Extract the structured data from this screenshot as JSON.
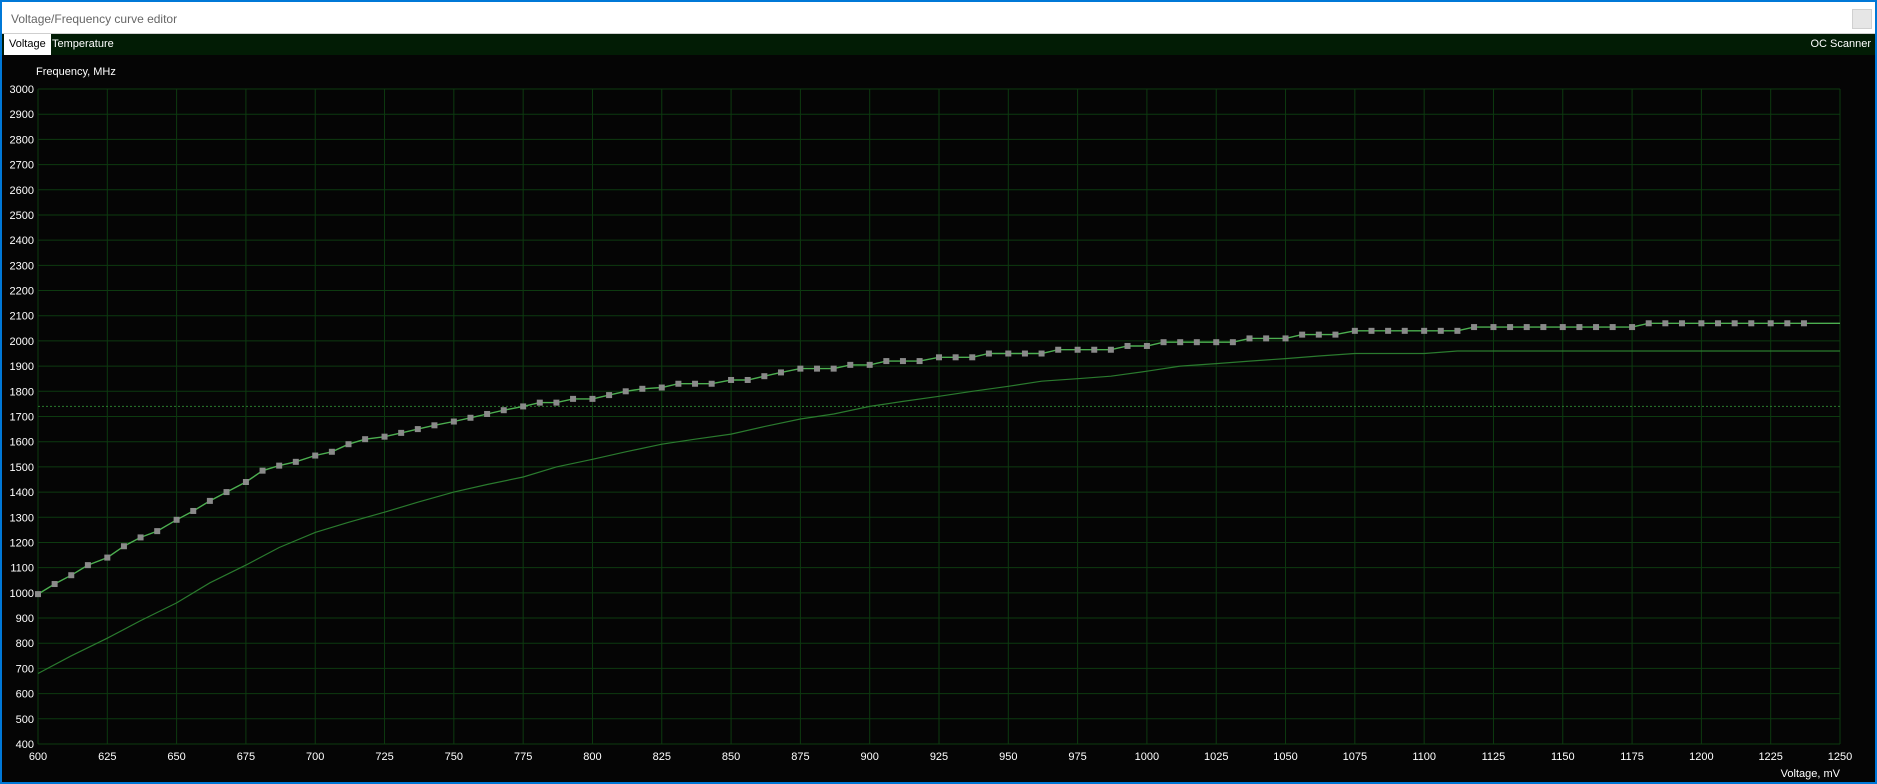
{
  "window": {
    "title": "Voltage/Frequency curve editor"
  },
  "tabs": [
    {
      "label": "Voltage"
    },
    {
      "label": "Temperature"
    }
  ],
  "oc_scanner": {
    "label": "OC Scanner"
  },
  "colors": {
    "background": "#050505",
    "grid": "#0d3a10",
    "curve": "#4caf50",
    "default_curve": "#2a7a2e",
    "point": "#8a8a8a",
    "limit_line": "#2a7a2e",
    "title_bar": "#ffffff",
    "tab_bar": "#021c05"
  },
  "chart_data": {
    "type": "line",
    "ylabel": "Frequency, MHz",
    "xlabel": "Voltage, mV",
    "xlim": [
      600,
      1250
    ],
    "ylim": [
      400,
      3000
    ],
    "x_ticks": [
      600,
      625,
      650,
      675,
      700,
      725,
      750,
      775,
      800,
      825,
      850,
      875,
      900,
      925,
      950,
      975,
      1000,
      1025,
      1050,
      1075,
      1100,
      1125,
      1150,
      1175,
      1200,
      1225,
      1250
    ],
    "y_ticks": [
      400,
      500,
      600,
      700,
      800,
      900,
      1000,
      1100,
      1200,
      1300,
      1400,
      1500,
      1600,
      1700,
      1800,
      1900,
      2000,
      2100,
      2200,
      2300,
      2400,
      2500,
      2600,
      2700,
      2800,
      2900,
      3000
    ],
    "grid": true,
    "limit_line_y": 1740,
    "series": [
      {
        "role": "edited curve",
        "has_points": true,
        "x": [
          600,
          606,
          612,
          618,
          625,
          631,
          637,
          643,
          650,
          656,
          662,
          668,
          675,
          681,
          687,
          693,
          700,
          706,
          712,
          718,
          725,
          731,
          737,
          743,
          750,
          756,
          762,
          768,
          775,
          781,
          787,
          793,
          800,
          806,
          812,
          818,
          825,
          831,
          837,
          843,
          850,
          856,
          862,
          868,
          875,
          881,
          887,
          893,
          900,
          906,
          912,
          918,
          925,
          931,
          937,
          943,
          950,
          956,
          962,
          968,
          975,
          981,
          987,
          993,
          1000,
          1006,
          1012,
          1018,
          1025,
          1031,
          1037,
          1043,
          1050,
          1056,
          1062,
          1068,
          1075,
          1081,
          1087,
          1093,
          1100,
          1106,
          1112,
          1118,
          1125,
          1131,
          1137,
          1143,
          1150,
          1156,
          1162,
          1168,
          1175,
          1181,
          1187,
          1193,
          1200,
          1206,
          1212,
          1218,
          1225,
          1231,
          1237
        ],
        "y": [
          995,
          1035,
          1070,
          1110,
          1140,
          1185,
          1220,
          1245,
          1290,
          1325,
          1365,
          1400,
          1440,
          1485,
          1505,
          1520,
          1545,
          1560,
          1590,
          1610,
          1620,
          1635,
          1650,
          1665,
          1680,
          1695,
          1710,
          1725,
          1740,
          1755,
          1755,
          1770,
          1770,
          1785,
          1800,
          1810,
          1815,
          1830,
          1830,
          1830,
          1845,
          1845,
          1860,
          1875,
          1890,
          1890,
          1890,
          1905,
          1905,
          1920,
          1920,
          1920,
          1935,
          1935,
          1935,
          1950,
          1950,
          1950,
          1950,
          1965,
          1965,
          1965,
          1965,
          1980,
          1980,
          1995,
          1995,
          1995,
          1995,
          1995,
          2010,
          2010,
          2010,
          2025,
          2025,
          2025,
          2040,
          2040,
          2040,
          2040,
          2040,
          2040,
          2040,
          2055,
          2055,
          2055,
          2055,
          2055,
          2055,
          2055,
          2055,
          2055,
          2055,
          2070,
          2070,
          2070,
          2070,
          2070,
          2070,
          2070,
          2070,
          2070,
          2070
        ]
      },
      {
        "role": "default curve",
        "has_points": false,
        "x": [
          600,
          612,
          625,
          637,
          650,
          662,
          675,
          687,
          700,
          712,
          725,
          737,
          750,
          762,
          775,
          787,
          800,
          812,
          825,
          837,
          850,
          862,
          875,
          887,
          900,
          912,
          925,
          937,
          950,
          962,
          975,
          987,
          1000,
          1012,
          1025,
          1037,
          1050,
          1062,
          1075,
          1087,
          1100,
          1112,
          1125,
          1137,
          1150,
          1162,
          1175,
          1187,
          1200,
          1212,
          1225,
          1237,
          1250
        ],
        "y": [
          680,
          750,
          820,
          890,
          960,
          1040,
          1110,
          1180,
          1240,
          1280,
          1320,
          1360,
          1400,
          1430,
          1460,
          1500,
          1530,
          1560,
          1590,
          1610,
          1630,
          1660,
          1690,
          1710,
          1740,
          1760,
          1780,
          1800,
          1820,
          1840,
          1850,
          1860,
          1880,
          1900,
          1910,
          1920,
          1930,
          1940,
          1950,
          1950,
          1950,
          1960,
          1960,
          1960,
          1960,
          1960,
          1960,
          1960,
          1960,
          1960,
          1960,
          1960,
          1960
        ]
      }
    ],
    "flat_tail": {
      "y": 2070,
      "x_end": 1250
    }
  }
}
